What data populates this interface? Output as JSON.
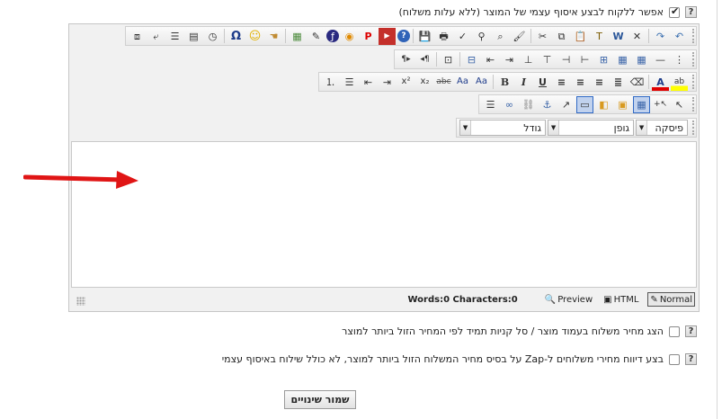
{
  "option_self_pickup": {
    "label": "אפשר ללקוח לבצע איסוף עצמי של המוצר (ללא עלות משלוח)",
    "checked": true
  },
  "option_show_shipping": {
    "label": "הצג מחיר משלוח בעמוד מוצר / סל קניות תמיד לפי המחיר הזול ביותר למוצר",
    "checked": false
  },
  "option_zap_report": {
    "label": "בצע דיווח מחירי משלוחים ל-Zap על בסיס מחיר המשלוח הזול ביותר למוצר, לא כולל שילוח באיסוף עצמי",
    "checked": false
  },
  "help_glyph": "?",
  "editor": {
    "paragraph_label": "פיסקה",
    "font_label": "גופן",
    "size_label": "גודל",
    "word_count": "Words:0 Characters:0",
    "preview_label": "Preview",
    "html_label": "HTML",
    "normal_label": "Normal",
    "dropdown_arrow": "▼",
    "toolbar": {
      "undo": "↶",
      "redo": "↷",
      "delete": "✕",
      "paste_word": "W",
      "paste_text": "T",
      "paste": "📋",
      "copy": "⧉",
      "cut": "✂",
      "format_painter": "🖌",
      "find": "⌕",
      "find_replace": "⚲",
      "spellcheck": "✓",
      "print": "🖶",
      "save": "💾",
      "help": "?",
      "youtube": "▶",
      "pdf": "P",
      "media": "◉",
      "flash": "ƒ",
      "edit_image": "✎",
      "image": "▦",
      "hand": "☚",
      "smiley": "☺",
      "omega": "Ω",
      "time": "◷",
      "date": "▤",
      "hr_list": "☰",
      "template": "⤶",
      "special": "⧈",
      "bullet_grip": "⋮",
      "line": "—",
      "table": "▦",
      "tbl_insert": "▦",
      "tbl_cell": "⊞",
      "col_left": "⊣",
      "col_right": "⊢",
      "row_ins": "⊤",
      "row_del": "⊥",
      "merge": "⇥",
      "split": "⇤",
      "tbl_props": "⊟",
      "border": "⊡",
      "ltr": "¶◂",
      "rtl": "▸¶",
      "highlight": "ab",
      "font_color": "A",
      "eraser": "⌫",
      "justify": "≣",
      "align_right": "≡",
      "align_center": "≡",
      "align_left": "≡",
      "underline": "U",
      "italic": "I",
      "bold": "B",
      "font_size_up": "Aa",
      "font_size_down": "Aa",
      "strike": "abc",
      "subscript": "x₂",
      "superscript": "x²",
      "indent": "⇥",
      "outdent": "⇤",
      "ul": "☰",
      "ol": "⒈",
      "select": "↖",
      "select_add": "↖+",
      "grid": "▦",
      "layer_back": "▣",
      "layer_front": "◧",
      "frame": "▭",
      "pointer": "↗",
      "anchor": "⚓",
      "unlink": "⛓",
      "link": "∞",
      "hr": "☰"
    }
  },
  "save_button": {
    "label": "שמור שינויים"
  },
  "colors": {
    "arrow": "#e01515",
    "toolbar_bg": "#ededed",
    "selected": "#c1d2ee"
  }
}
